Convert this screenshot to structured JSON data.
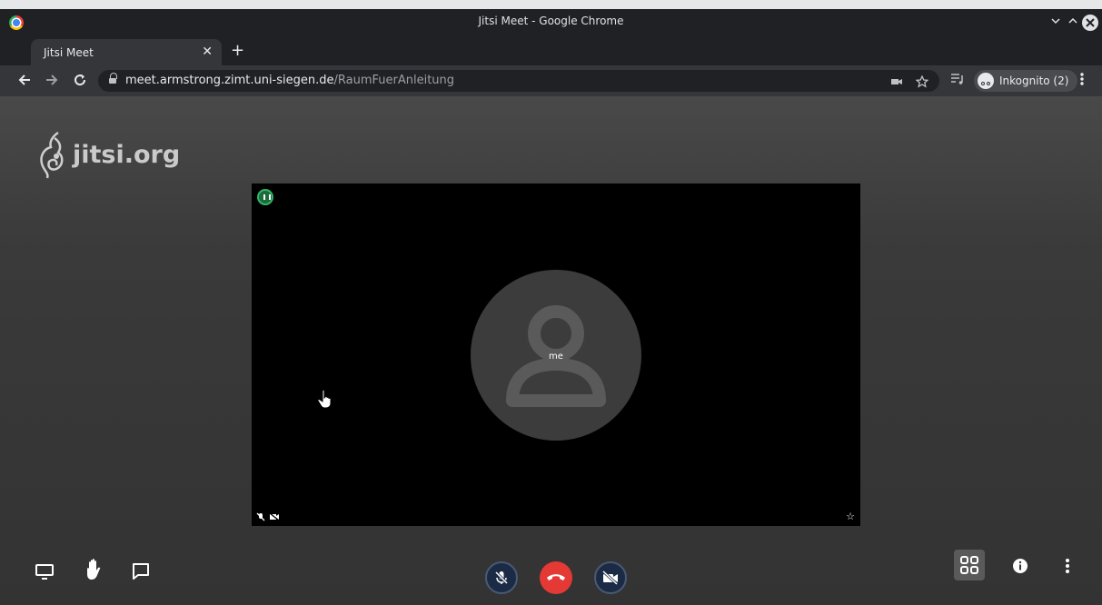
{
  "window": {
    "title": "Jitsi Meet - Google Chrome"
  },
  "tab": {
    "label": "Jitsi Meet"
  },
  "address": {
    "host": "meet.armstrong.zimt.uni-siegen.de",
    "path": "/RaumFuerAnleitung"
  },
  "profile": {
    "label": "Inkognito (2)"
  },
  "meet": {
    "logo_text": "jitsi.org",
    "participant_name": "me"
  },
  "colors": {
    "hangup": "#e53935",
    "connection_good": "#31b76a",
    "toolbar_dark": "#35363a"
  },
  "icons": {
    "toolbar_left": [
      "screen-share-icon",
      "raise-hand-icon",
      "chat-icon"
    ],
    "toolbar_center": [
      "mic-muted-icon",
      "hangup-icon",
      "camera-off-icon"
    ],
    "toolbar_right": [
      "tile-view-icon",
      "info-icon",
      "more-icon"
    ]
  }
}
